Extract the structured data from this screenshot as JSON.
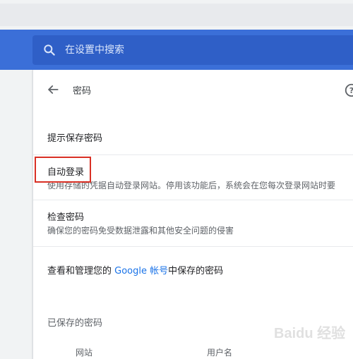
{
  "search": {
    "placeholder": "在设置中搜索"
  },
  "page": {
    "title": "密码"
  },
  "settings": {
    "offer_to_save": {
      "title": "提示保存密码"
    },
    "auto_signin": {
      "title": "自动登录",
      "description": "使用存储的凭据自动登录网站。停用该功能后，系统会在您每次登录网站时要"
    },
    "check_passwords": {
      "title": "检查密码",
      "description": "确保您的密码免受数据泄露和其他安全问题的侵害"
    },
    "manage_account": {
      "prefix": "查看和管理您的 ",
      "link": "Google 帐号",
      "suffix": "中保存的密码"
    }
  },
  "saved_passwords": {
    "label": "已保存的密码",
    "columns": [
      "网站",
      "用户名"
    ]
  },
  "watermark": {
    "text": "Baidu 经验"
  },
  "icons": {
    "search": "search-icon",
    "back": "arrow-back-icon",
    "help": "help-circle-icon"
  },
  "colors": {
    "header": "#3b6fd8",
    "highlight": "#d93025",
    "link": "#1a73e8"
  }
}
